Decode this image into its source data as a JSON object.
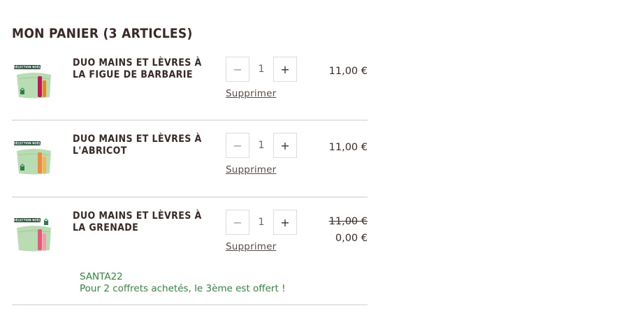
{
  "cart": {
    "title": "MON PANIER (3 ARTICLES)",
    "remove_label": "Supprimer",
    "items": [
      {
        "name": "DUO MAINS ET LÈVRES À LA FIGUE DE BARBARIE",
        "quantity": "1",
        "price": "11,00 €",
        "badge": "SÉLECTION NOËL",
        "product_color": "#c2185b"
      },
      {
        "name": "DUO MAINS ET LÈVRES À L'ABRICOT",
        "quantity": "1",
        "price": "11,00 €",
        "badge": "SÉLECTION NOËL",
        "product_color": "#f08a3c"
      },
      {
        "name": "DUO MAINS ET LÈVRES À LA GRENADE",
        "quantity": "1",
        "original_price": "11,00 €",
        "price": "0,00 €",
        "badge": "SÉLECTION NOËL",
        "product_color": "#e75a7c",
        "promo_code": "SANTA22",
        "promo_text": "Pour 2 coffrets achetés, le 3ème est offert !"
      }
    ]
  },
  "controls": {
    "minus": "−",
    "plus": "+"
  },
  "colors": {
    "promo": "#2e8b3a",
    "divider": "#dfe6e4",
    "pouch": "#b9dcb3",
    "badge": "#1f4a32"
  }
}
